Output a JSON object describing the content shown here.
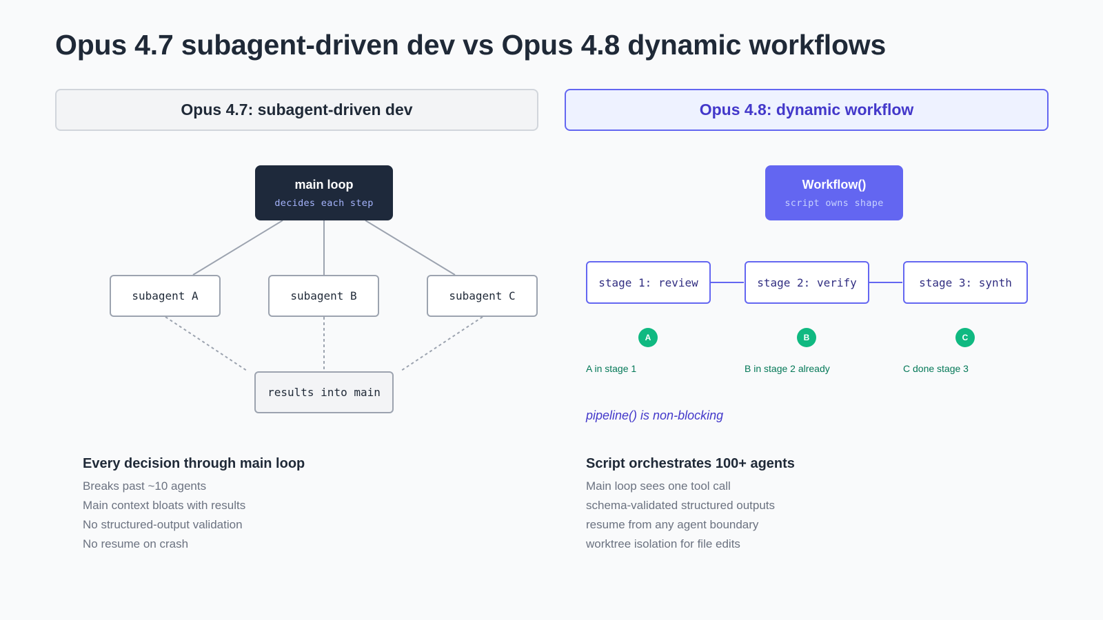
{
  "title": "Opus 4.7 subagent-driven dev vs Opus 4.8 dynamic workflows",
  "left": {
    "header": "Opus 4.7: subagent-driven dev",
    "main_loop": {
      "title": "main loop",
      "subtitle": "decides each step"
    },
    "subagents": [
      "subagent A",
      "subagent B",
      "subagent C"
    ],
    "results": "results into main",
    "heading": "Every decision through main loop",
    "bullets": [
      "Breaks past ~10 agents",
      "Main context bloats with results",
      "No structured-output validation",
      "No resume on crash"
    ]
  },
  "right": {
    "header": "Opus 4.8: dynamic workflow",
    "workflow": {
      "title": "Workflow()",
      "subtitle": "script owns shape"
    },
    "stages": [
      "stage 1: review",
      "stage 2: verify",
      "stage 3: synth"
    ],
    "agents": [
      {
        "badge": "A",
        "label": "A in stage 1"
      },
      {
        "badge": "B",
        "label": "B in stage 2 already"
      },
      {
        "badge": "C",
        "label": "C done stage 3"
      }
    ],
    "note": "pipeline() is non-blocking",
    "heading": "Script orchestrates 100+ agents",
    "bullets": [
      "Main loop sees one tool call",
      "schema-validated structured outputs",
      "resume from any agent boundary",
      "worktree isolation for file edits"
    ]
  },
  "colors": {
    "accent": "#6366f1",
    "dark_node": "#1e293b",
    "agent_badge": "#10b981",
    "agent_text": "#047857"
  }
}
